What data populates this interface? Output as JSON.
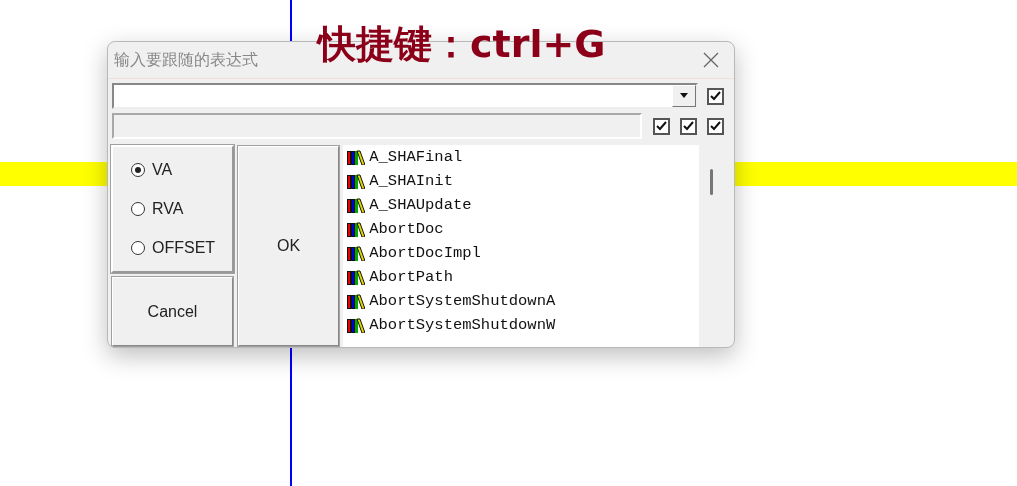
{
  "annotation": "快捷键：ctrl+G",
  "window": {
    "title": "输入要跟随的表达式"
  },
  "top_checks": [
    {
      "checked": true
    }
  ],
  "row_checks": [
    {
      "checked": true
    },
    {
      "checked": true
    },
    {
      "checked": true
    }
  ],
  "address_modes": [
    {
      "label": "VA",
      "selected": true
    },
    {
      "label": "RVA",
      "selected": false
    },
    {
      "label": "OFFSET",
      "selected": false
    }
  ],
  "buttons": {
    "ok": "OK",
    "cancel": "Cancel"
  },
  "symbols": [
    {
      "name": "A_SHAFinal"
    },
    {
      "name": "A_SHAInit"
    },
    {
      "name": "A_SHAUpdate"
    },
    {
      "name": "AbortDoc"
    },
    {
      "name": "AbortDocImpl"
    },
    {
      "name": "AbortPath"
    },
    {
      "name": "AbortSystemShutdownA"
    },
    {
      "name": "AbortSystemShutdownW"
    }
  ]
}
